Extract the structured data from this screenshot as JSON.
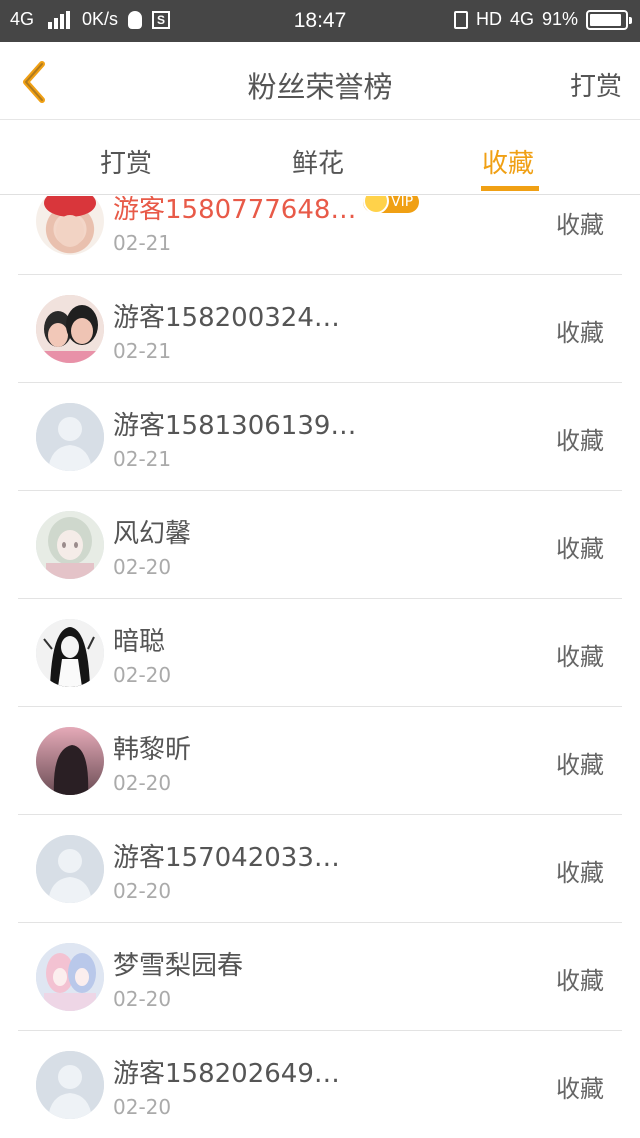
{
  "status_bar": {
    "network": "4G",
    "speed": "0K/s",
    "time": "18:47",
    "hd": "HD",
    "data_type": "4G",
    "battery": "91%",
    "battery_level": 0.91
  },
  "header": {
    "title": "粉丝荣誉榜",
    "action": "打赏"
  },
  "tabs": [
    {
      "label": "打赏",
      "active": false
    },
    {
      "label": "鲜花",
      "active": false
    },
    {
      "label": "收藏",
      "active": true
    }
  ],
  "list": [
    {
      "name": "游客1580777648…",
      "date": "02-21",
      "action": "收藏",
      "vip": true,
      "vip_label": "VIP",
      "avatar": "avatar-girl-red-hat"
    },
    {
      "name": "游客158200324…",
      "date": "02-21",
      "action": "收藏",
      "vip": false,
      "avatar": "avatar-couple-photo"
    },
    {
      "name": "游客1581306139…",
      "date": "02-21",
      "action": "收藏",
      "vip": false,
      "avatar": "default-avatar-icon"
    },
    {
      "name": "风幻馨",
      "date": "02-20",
      "action": "收藏",
      "vip": false,
      "avatar": "avatar-anime-girl"
    },
    {
      "name": "暗聪",
      "date": "02-20",
      "action": "收藏",
      "vip": false,
      "avatar": "avatar-dark-girl"
    },
    {
      "name": "韩黎昕",
      "date": "02-20",
      "action": "收藏",
      "vip": false,
      "avatar": "avatar-silhouette"
    },
    {
      "name": "游客157042033…",
      "date": "02-20",
      "action": "收藏",
      "vip": false,
      "avatar": "default-avatar-icon"
    },
    {
      "name": "梦雪梨园春",
      "date": "02-20",
      "action": "收藏",
      "vip": false,
      "avatar": "avatar-anime-pink"
    },
    {
      "name": "游客158202649…",
      "date": "02-20",
      "action": "收藏",
      "vip": false,
      "avatar": "default-avatar-icon"
    }
  ],
  "colors": {
    "accent": "#f0a014",
    "vip_name": "#e85a48",
    "status_bar": "#464646"
  }
}
